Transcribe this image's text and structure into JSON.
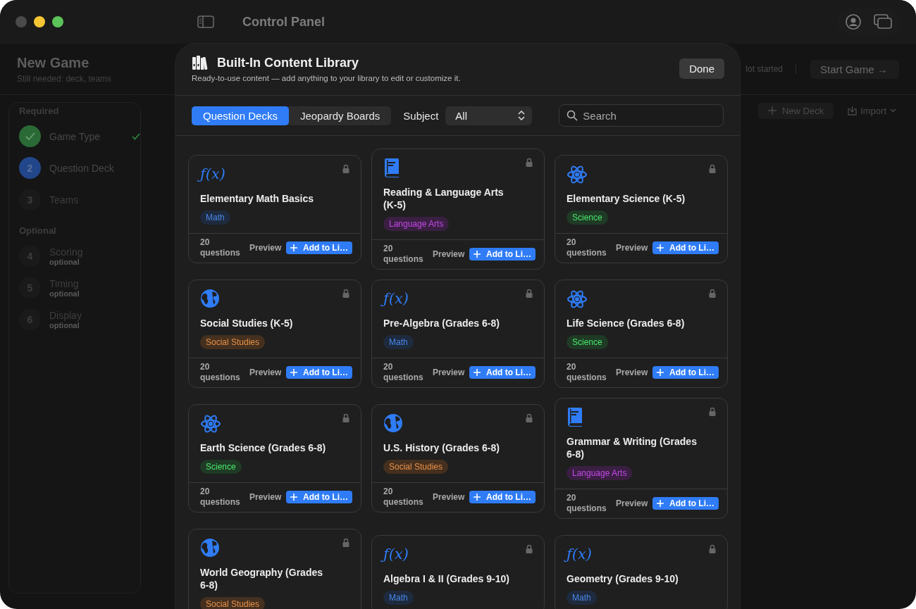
{
  "window": {
    "title": "Control Panel"
  },
  "header": {
    "title": "New Game",
    "subtitle": "Still needed: deck, teams",
    "status": "lot started",
    "start_button": {
      "label": "Start Game →",
      "disabled": true
    }
  },
  "steps_panel": {
    "sections": [
      {
        "title": "Required",
        "steps": [
          {
            "label": "Game Type",
            "done": true,
            "selected": false
          },
          {
            "number": "2",
            "label": "Question Deck",
            "done": false,
            "selected": true
          },
          {
            "number": "3",
            "label": "Teams",
            "done": false,
            "selected": false
          }
        ]
      },
      {
        "title": "Optional",
        "steps": [
          {
            "number": "4",
            "label": "Scoring",
            "note": "optional",
            "done": false,
            "selected": false
          },
          {
            "number": "5",
            "label": "Timing",
            "note": "optional",
            "done": false,
            "selected": false
          },
          {
            "number": "6",
            "label": "Display",
            "note": "optional",
            "done": false,
            "selected": false
          }
        ]
      }
    ]
  },
  "toolbar": {
    "new_deck": "New Deck",
    "import": "Import"
  },
  "library": {
    "title": "Built-In Content Library",
    "subtitle": "Ready-to-use content — add anything to your library to edit or customize it.",
    "done": "Done",
    "tabs": [
      {
        "label": "Question Decks",
        "selected": true
      },
      {
        "label": "Jeopardy Boards",
        "selected": false
      }
    ],
    "subject_label": "Subject",
    "subject_value": "All",
    "search": {
      "placeholder": "Search"
    },
    "decks": [
      {
        "kind": "function",
        "symbol": "ƒ(x)",
        "title": "Elementary Math Basics",
        "tag": "Math",
        "color": "#1e2a3d",
        "locked": true,
        "count": "20 questions",
        "preview": "Preview",
        "add": "Add to Li…"
      },
      {
        "kind": "book",
        "title": "Reading & Language Arts (K-5)",
        "tag": "Language Arts",
        "color": "#3a1f42",
        "locked": true,
        "count": "20 questions",
        "preview": "Preview",
        "add": "Add to Li…"
      },
      {
        "kind": "atom",
        "title": "Elementary Science (K-5)",
        "tag": "Science",
        "color": "#1f3a25",
        "locked": true,
        "count": "20 questions",
        "preview": "Preview",
        "add": "Add to Li…"
      },
      {
        "kind": "globe",
        "title": "Social Studies (K-5)",
        "tag": "Social Studies",
        "color": "#45301f",
        "locked": true,
        "count": "20 questions",
        "preview": "Preview",
        "add": "Add to Li…"
      },
      {
        "kind": "function",
        "symbol": "ƒ(x)",
        "title": "Pre-Algebra (Grades 6-8)",
        "tag": "Math",
        "color": "#1e2a3d",
        "locked": true,
        "count": "20 questions",
        "preview": "Preview",
        "add": "Add to Li…"
      },
      {
        "kind": "atom",
        "title": "Life Science (Grades 6-8)",
        "tag": "Science",
        "color": "#1f3a25",
        "locked": true,
        "count": "20 questions",
        "preview": "Preview",
        "add": "Add to Li…"
      },
      {
        "kind": "atom",
        "title": "Earth Science (Grades 6-8)",
        "tag": "Science",
        "color": "#1f3a25",
        "locked": true,
        "count": "20 questions",
        "preview": "Preview",
        "add": "Add to Li…"
      },
      {
        "kind": "globe",
        "title": "U.S. History (Grades 6-8)",
        "tag": "Social Studies",
        "color": "#45301f",
        "locked": true,
        "count": "20 questions",
        "preview": "Preview",
        "add": "Add to Li…"
      },
      {
        "kind": "book",
        "title": "Grammar & Writing (Grades 6-8)",
        "tag": "Language Arts",
        "color": "#3a1f42",
        "locked": true,
        "count": "20 questions",
        "preview": "Preview",
        "add": "Add to Li…"
      },
      {
        "kind": "globe",
        "title": "World Geography (Grades 6-8)",
        "tag": "Social Studies",
        "color": "#45301f",
        "locked": true
      },
      {
        "kind": "function",
        "symbol": "ƒ(x)",
        "title": "Algebra I & II (Grades 9-10)",
        "tag": "Math",
        "color": "#1e2a3d",
        "locked": true
      },
      {
        "kind": "function",
        "symbol": "ƒ(x)",
        "title": "Geometry (Grades 9-10)",
        "tag": "Math",
        "color": "#1e2a3d",
        "locked": true
      }
    ]
  }
}
